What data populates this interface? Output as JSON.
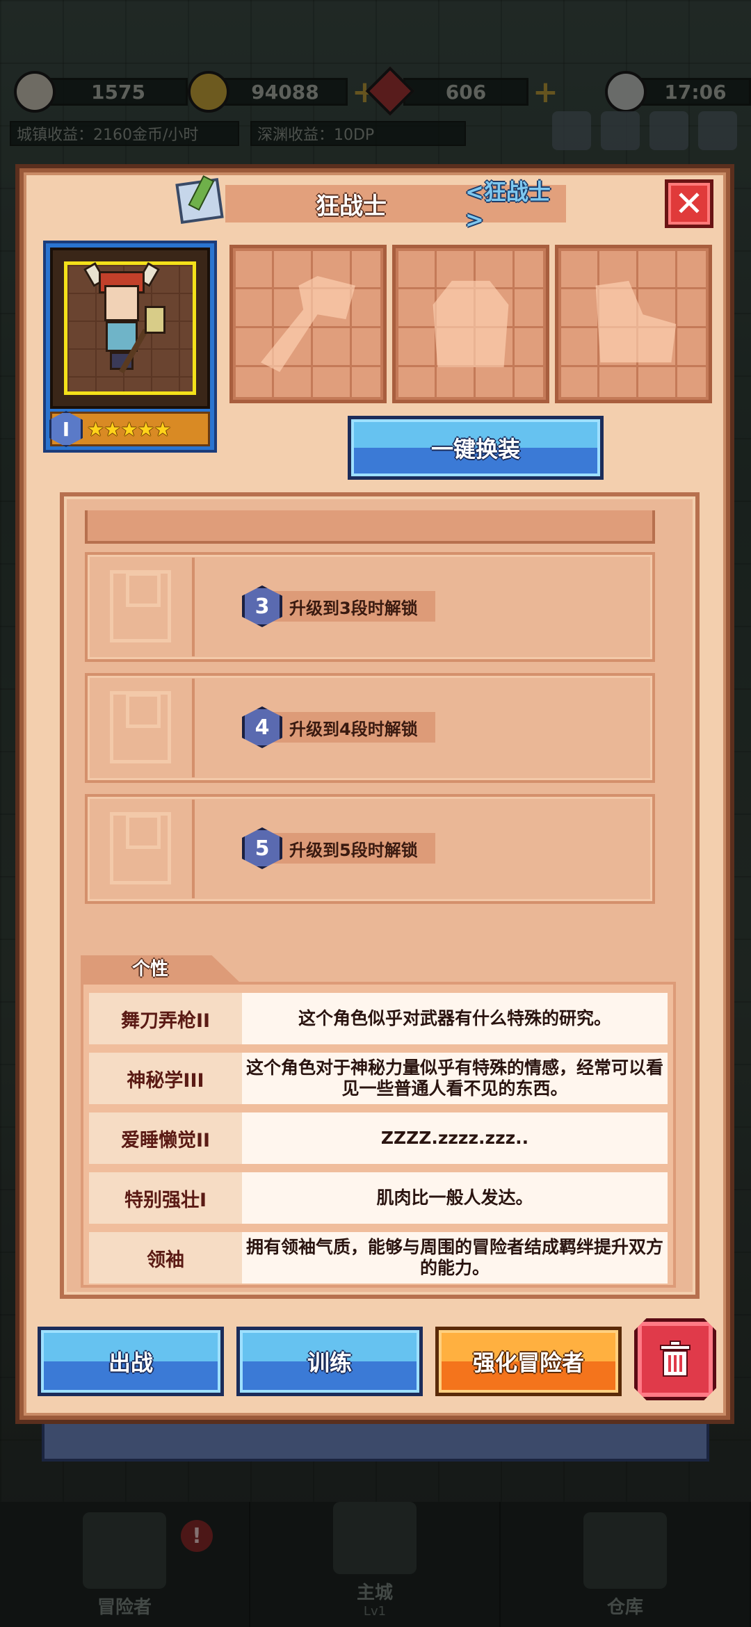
{
  "topbar": {
    "energy": "1575",
    "gold": "94088",
    "gems": "606",
    "time": "17:06",
    "town_income": "城镇收益：2160金币/小时",
    "abyss_income": "深渊收益：10DP"
  },
  "modal": {
    "hero_name": "狂战士",
    "hero_class": "<狂战士>",
    "close_label": "✕",
    "grade": "I",
    "stars": "★★★★★",
    "equip_all_label": "一键换装",
    "locked_skills": [
      {
        "num": "3",
        "text": "升级到3段时解锁"
      },
      {
        "num": "4",
        "text": "升级到4段时解锁"
      },
      {
        "num": "5",
        "text": "升级到5段时解锁"
      }
    ],
    "traits_title": "个性",
    "traits": [
      {
        "name": "舞刀弄枪II",
        "desc": "这个角色似乎对武器有什么特殊的研究。"
      },
      {
        "name": "神秘学III",
        "desc": "这个角色对于神秘力量似乎有特殊的情感，经常可以看见一些普通人看不见的东西。"
      },
      {
        "name": "爱睡懒觉II",
        "desc": "ZZZZ.zzzz.zzz.."
      },
      {
        "name": "特别强壮I",
        "desc": "肌肉比一般人发达。"
      },
      {
        "name": "领袖",
        "desc": "拥有领袖气质，能够与周围的冒险者结成羁绊提升双方的能力。"
      }
    ],
    "buttons": {
      "battle": "出战",
      "train": "训练",
      "enhance": "强化冒险者",
      "delete_icon": "trash-icon"
    }
  },
  "bottom_nav": {
    "adventurers": "冒险者",
    "main_city": "主城",
    "main_city_level": "Lv1",
    "warehouse": "仓库",
    "badge": "!"
  },
  "colors": {
    "panel_bg": "#f3cfae",
    "accent_blue": "#3b7ad6",
    "accent_orange": "#f4741c",
    "accent_red": "#e03a4a"
  }
}
